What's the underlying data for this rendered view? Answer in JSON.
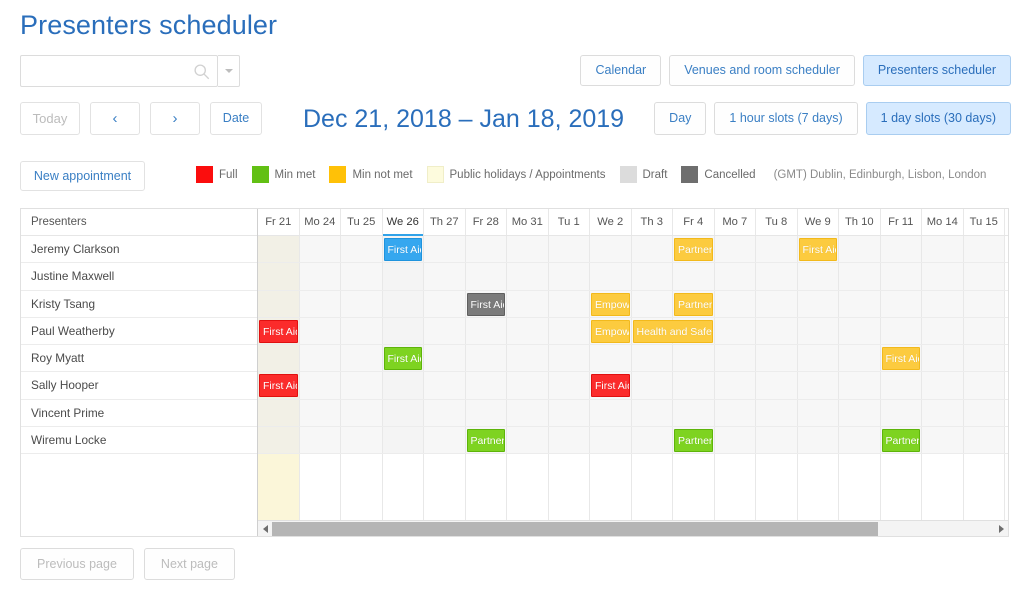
{
  "page_title": "Presenters scheduler",
  "search": {
    "value": "",
    "placeholder": "",
    "icon": "search-icon",
    "caret_icon": "chevron-down-icon"
  },
  "view_tabs": [
    {
      "label": "Calendar",
      "active": false
    },
    {
      "label": "Venues and room scheduler",
      "active": false
    },
    {
      "label": "Presenters scheduler",
      "active": true
    }
  ],
  "nav": {
    "today": "Today",
    "prev": "‹",
    "next": "›",
    "date": "Date",
    "range": "Dec 21, 2018 – Jan 18, 2019"
  },
  "slot_tabs": [
    {
      "label": "Day",
      "active": false
    },
    {
      "label": "1 hour slots (7 days)",
      "active": false
    },
    {
      "label": "1 day slots (30 days)",
      "active": true
    }
  ],
  "new_appointment": "New appointment",
  "legend": [
    {
      "label": "Full",
      "color": "#fb0d0d"
    },
    {
      "label": "Min met",
      "color": "#62c014"
    },
    {
      "label": "Min not met",
      "color": "#ffc107"
    },
    {
      "label": "Public holidays / Appointments",
      "color": "#fdfbdd"
    },
    {
      "label": "Draft",
      "color": "#dcdcdc"
    },
    {
      "label": "Cancelled",
      "color": "#6e6e6e"
    }
  ],
  "timezone": "(GMT) Dublin, Edinburgh, Lisbon, London",
  "grid": {
    "presenters_header": "Presenters",
    "days": [
      {
        "label": "Fr 21",
        "holiday": true,
        "today": false
      },
      {
        "label": "Mo 24",
        "holiday": false,
        "today": false
      },
      {
        "label": "Tu 25",
        "holiday": false,
        "today": false
      },
      {
        "label": "We 26",
        "holiday": false,
        "today": true
      },
      {
        "label": "Th 27",
        "holiday": false,
        "today": false
      },
      {
        "label": "Fr 28",
        "holiday": false,
        "today": false
      },
      {
        "label": "Mo 31",
        "holiday": false,
        "today": false
      },
      {
        "label": "Tu 1",
        "holiday": false,
        "today": false
      },
      {
        "label": "We 2",
        "holiday": false,
        "today": false
      },
      {
        "label": "Th 3",
        "holiday": false,
        "today": false
      },
      {
        "label": "Fr 4",
        "holiday": false,
        "today": false
      },
      {
        "label": "Mo 7",
        "holiday": false,
        "today": false
      },
      {
        "label": "Tu 8",
        "holiday": false,
        "today": false
      },
      {
        "label": "We 9",
        "holiday": false,
        "today": false
      },
      {
        "label": "Th 10",
        "holiday": false,
        "today": false
      },
      {
        "label": "Fr 11",
        "holiday": false,
        "today": false
      },
      {
        "label": "Mo 14",
        "holiday": false,
        "today": false
      },
      {
        "label": "Tu 15",
        "holiday": false,
        "today": false
      }
    ],
    "rows": [
      {
        "presenter": "Jeremy Clarkson",
        "events": [
          {
            "label": "First Aid",
            "start": 3,
            "span": 1,
            "status": "today"
          },
          {
            "label": "Partner",
            "start": 10,
            "span": 1,
            "status": "minnotmet"
          },
          {
            "label": "First Aid",
            "start": 13,
            "span": 1,
            "status": "minnotmet"
          }
        ]
      },
      {
        "presenter": "Justine Maxwell",
        "events": []
      },
      {
        "presenter": "Kristy Tsang",
        "events": [
          {
            "label": "First Aid",
            "start": 5,
            "span": 1,
            "status": "cancelled"
          },
          {
            "label": "Empowerment",
            "start": 8,
            "span": 1,
            "status": "minnotmet"
          },
          {
            "label": "Partner",
            "start": 10,
            "span": 1,
            "status": "minnotmet"
          }
        ]
      },
      {
        "presenter": "Paul Weatherby",
        "events": [
          {
            "label": "First Aid",
            "start": 0,
            "span": 1,
            "status": "full"
          },
          {
            "label": "Empowerment",
            "start": 8,
            "span": 1,
            "status": "minnotmet"
          },
          {
            "label": "Health and Safety",
            "start": 9,
            "span": 2,
            "status": "minnotmet"
          }
        ]
      },
      {
        "presenter": "Roy Myatt",
        "events": [
          {
            "label": "First Aid",
            "start": 3,
            "span": 1,
            "status": "minmet"
          },
          {
            "label": "First Aid",
            "start": 15,
            "span": 1,
            "status": "minnotmet"
          }
        ]
      },
      {
        "presenter": "Sally Hooper",
        "events": [
          {
            "label": "First Aid",
            "start": 0,
            "span": 1,
            "status": "full"
          },
          {
            "label": "First Aid",
            "start": 8,
            "span": 1,
            "status": "full"
          }
        ]
      },
      {
        "presenter": "Vincent Prime",
        "events": []
      },
      {
        "presenter": "Wiremu Locke",
        "events": [
          {
            "label": "Partner",
            "start": 5,
            "span": 1,
            "status": "minmet"
          },
          {
            "label": "Partner",
            "start": 10,
            "span": 1,
            "status": "minmet"
          },
          {
            "label": "Partner",
            "start": 15,
            "span": 1,
            "status": "minmet"
          }
        ]
      }
    ],
    "scrollbar": {
      "left_arrow": "scroll-left-icon",
      "right_arrow": "scroll-right-icon",
      "thumb_percent": 84
    }
  },
  "pager": {
    "previous": "Previous page",
    "next": "Next page"
  }
}
